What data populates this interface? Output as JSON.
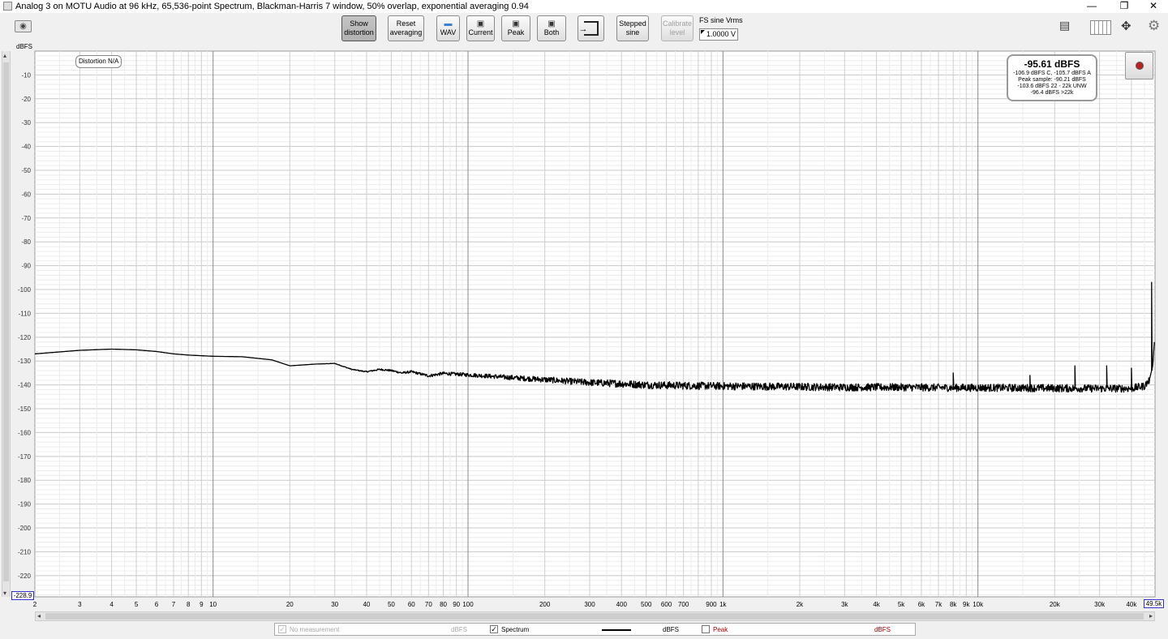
{
  "window": {
    "title": "Analog 3 on MOTU Audio at 96 kHz, 65,536-point Spectrum, Blackman-Harris 7 window, 50% overlap, exponential averaging 0.94",
    "controls": {
      "minimize": "—",
      "restore": "❐",
      "close": "✕"
    }
  },
  "toolbar": {
    "show_distortion": {
      "line1": "Show",
      "line2": "distortion"
    },
    "reset_averaging": {
      "line1": "Reset",
      "line2": "averaging"
    },
    "wav": "WAV",
    "current": "Current",
    "peak": "Peak",
    "both": "Both",
    "stepped_sine": {
      "line1": "Stepped",
      "line2": "sine"
    },
    "calibrate_level": {
      "line1": "Calibrate",
      "line2": "level"
    },
    "fs_label": "FS sine Vrms",
    "fs_value": "1.0000 V"
  },
  "icons": {
    "camera": "camera-icon",
    "wav": "folder-icon",
    "save": "floppy-icon",
    "export": "export-icon",
    "layout": "layout-icon",
    "columns": "columns-icon",
    "expand": "expand-arrows-icon",
    "settings": "gear-icon",
    "record": "record-icon"
  },
  "plot": {
    "unit": "dBFS",
    "ymin_value": "-228.9",
    "xmax_value": "49.5k",
    "distortion_tag": "Distortion N/A",
    "readout": {
      "main": "-95.61 dBFS",
      "line1": "-106.9 dBFS C, -105.7 dBFS A",
      "line2": "Peak sample: -90.21 dBFS",
      "line3": "-103.6 dBFS 22 - 22k UNW",
      "line4": "-96.4 dBFS >22k"
    }
  },
  "legend": {
    "no_measurement": "No measurement",
    "no_measurement_unit": "dBFS",
    "spectrum": "Spectrum",
    "spectrum_unit": "dBFS",
    "peak": "Peak",
    "peak_unit": "dBFS",
    "spectrum_checked": true,
    "peak_checked": false,
    "peak_color": "#a00000"
  },
  "chart_data": {
    "type": "line",
    "title": "",
    "xlabel": "",
    "ylabel": "dBFS",
    "x_scale": "log",
    "xlim": [
      2,
      49500
    ],
    "ylim": [
      -228.9,
      0
    ],
    "grid": true,
    "y_ticks": [
      -10,
      -20,
      -30,
      -40,
      -50,
      -60,
      -70,
      -80,
      -90,
      -100,
      -110,
      -120,
      -130,
      -140,
      -150,
      -160,
      -170,
      -180,
      -190,
      -200,
      -210,
      -220
    ],
    "x_tick_labels": [
      {
        "v": 2,
        "t": "2"
      },
      {
        "v": 3,
        "t": "3"
      },
      {
        "v": 4,
        "t": "4"
      },
      {
        "v": 5,
        "t": "5"
      },
      {
        "v": 6,
        "t": "6"
      },
      {
        "v": 7,
        "t": "7"
      },
      {
        "v": 8,
        "t": "8"
      },
      {
        "v": 9,
        "t": "9"
      },
      {
        "v": 10,
        "t": "10"
      },
      {
        "v": 20,
        "t": "20"
      },
      {
        "v": 30,
        "t": "30"
      },
      {
        "v": 40,
        "t": "40"
      },
      {
        "v": 50,
        "t": "50"
      },
      {
        "v": 60,
        "t": "60"
      },
      {
        "v": 70,
        "t": "70"
      },
      {
        "v": 80,
        "t": "80"
      },
      {
        "v": 90,
        "t": "90"
      },
      {
        "v": 100,
        "t": "100"
      },
      {
        "v": 200,
        "t": "200"
      },
      {
        "v": 300,
        "t": "300"
      },
      {
        "v": 400,
        "t": "400"
      },
      {
        "v": 500,
        "t": "500"
      },
      {
        "v": 600,
        "t": "600"
      },
      {
        "v": 700,
        "t": "700"
      },
      {
        "v": 900,
        "t": "900"
      },
      {
        "v": 1000,
        "t": "1k"
      },
      {
        "v": 2000,
        "t": "2k"
      },
      {
        "v": 3000,
        "t": "3k"
      },
      {
        "v": 4000,
        "t": "4k"
      },
      {
        "v": 5000,
        "t": "5k"
      },
      {
        "v": 6000,
        "t": "6k"
      },
      {
        "v": 7000,
        "t": "7k"
      },
      {
        "v": 8000,
        "t": "8k"
      },
      {
        "v": 9000,
        "t": "9k"
      },
      {
        "v": 10000,
        "t": "10k"
      },
      {
        "v": 20000,
        "t": "20k"
      },
      {
        "v": 30000,
        "t": "30k"
      },
      {
        "v": 40000,
        "t": "40k"
      }
    ],
    "series": [
      {
        "values_x": [
          2,
          3,
          4,
          5,
          6,
          7,
          8,
          10,
          13,
          17,
          20,
          25,
          30,
          35,
          40,
          45,
          50,
          55,
          60,
          70,
          80,
          90,
          100,
          120,
          150,
          200,
          250,
          300,
          400,
          500,
          700,
          1000,
          2000,
          3000,
          5000,
          8000,
          10000,
          15000,
          20000,
          30000,
          40000,
          45000,
          47000,
          48500,
          49200
        ],
        "values_y": [
          -127,
          -125.5,
          -125,
          -125.3,
          -126,
          -127,
          -127.5,
          -128,
          -128.2,
          -129.5,
          -132,
          -131.3,
          -131,
          -133.5,
          -134.5,
          -133.5,
          -134,
          -135,
          -134.5,
          -136.2,
          -135.2,
          -135.5,
          -135.8,
          -136.3,
          -137,
          -137.8,
          -138.5,
          -139,
          -139.5,
          -140,
          -140.3,
          -140.5,
          -140.8,
          -141,
          -141,
          -141.2,
          -141.2,
          -141.3,
          -141.4,
          -141.5,
          -141.5,
          -140.5,
          -138,
          -132,
          -122
        ]
      }
    ],
    "spikes": [
      {
        "x": 8000,
        "y": -135
      },
      {
        "x": 16000,
        "y": -136
      },
      {
        "x": 24000,
        "y": -132
      },
      {
        "x": 32000,
        "y": -132
      },
      {
        "x": 40000,
        "y": -133
      },
      {
        "x": 48000,
        "y": -97
      }
    ],
    "noise_amplitude_db": 1.6,
    "line_color": "#000000"
  }
}
